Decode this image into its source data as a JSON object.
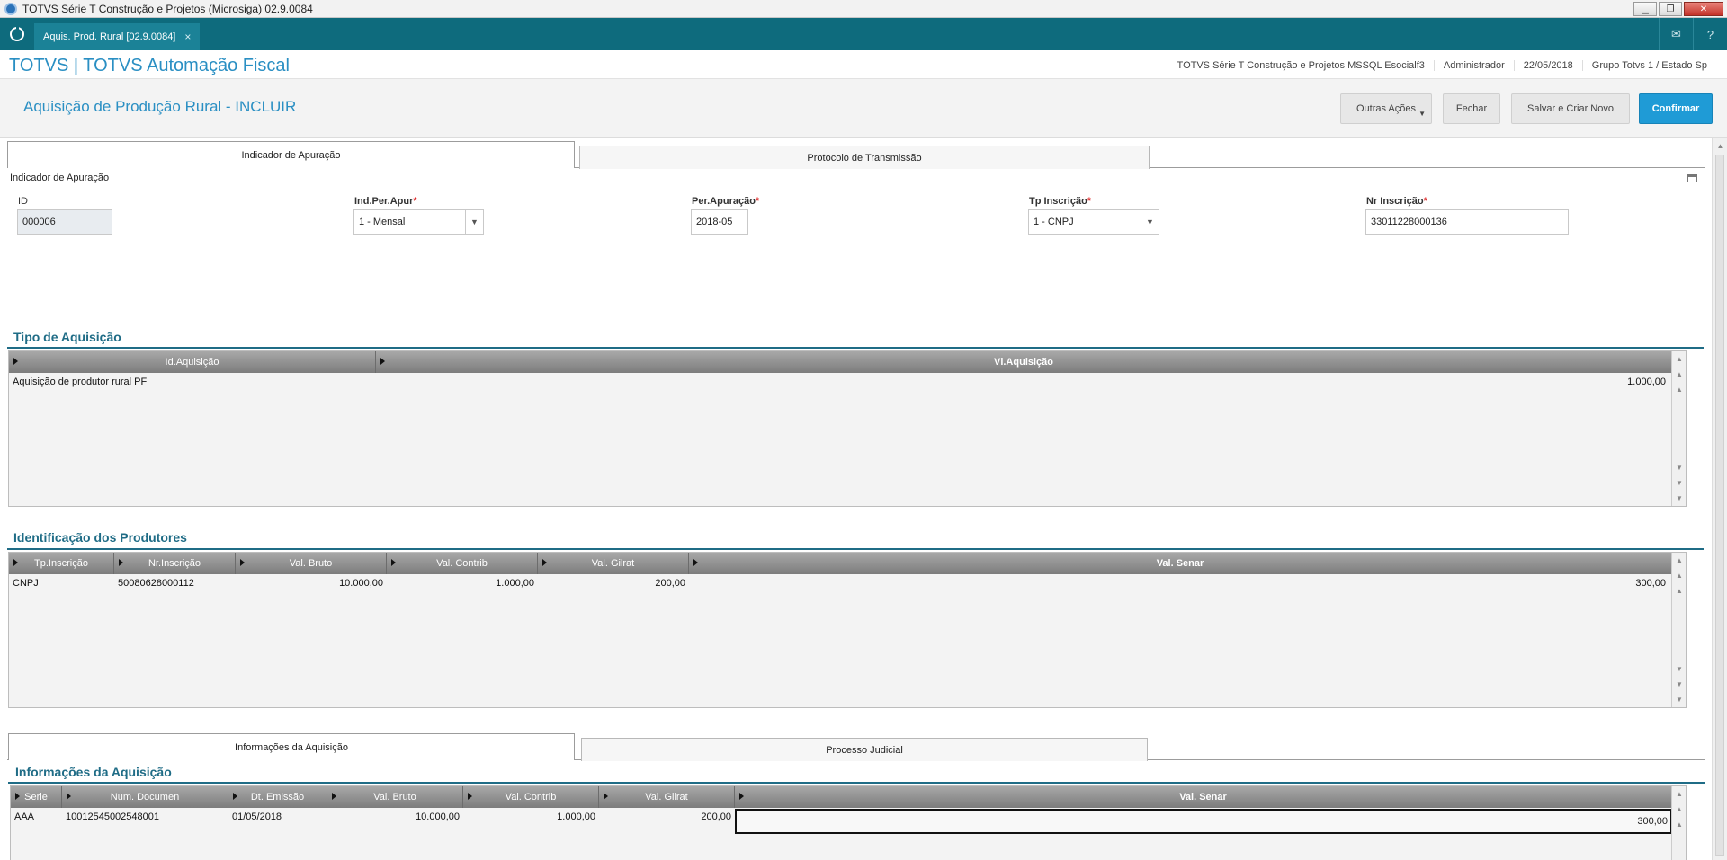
{
  "window": {
    "title": "TOTVS Série T Construção e Projetos (Microsiga) 02.9.0084"
  },
  "app_tab": {
    "label": "Aquis. Prod. Rural [02.9.0084]",
    "close": "×"
  },
  "topbar_icons": {
    "mail": "✉",
    "help": "?"
  },
  "header": {
    "brand": "TOTVS | TOTVS Automação Fiscal",
    "info": [
      "TOTVS Série T Construção e Projetos MSSQL Esocialf3",
      "Administrador",
      "22/05/2018",
      "Grupo Totvs 1 / Estado Sp"
    ]
  },
  "page": {
    "title": "Aquisição de Produção Rural - INCLUIR"
  },
  "actions": {
    "outras": "Outras Ações",
    "fechar": "Fechar",
    "salvar_novo": "Salvar e Criar Novo",
    "confirmar": "Confirmar"
  },
  "top_tabs": [
    "Indicador de Apuração",
    "Protocolo de Transmissão"
  ],
  "form": {
    "group_label": "Indicador de Apuração",
    "id": {
      "label": "ID",
      "value": "000006"
    },
    "ind_per_apur": {
      "label": "Ind.Per.Apur",
      "value": "1 - Mensal"
    },
    "per_apuracao": {
      "label": "Per.Apuração",
      "value": "2018-05"
    },
    "tp_inscricao": {
      "label": "Tp Inscrição",
      "value": "1 - CNPJ"
    },
    "nr_inscricao": {
      "label": "Nr Inscrição",
      "value": "33011228000136"
    },
    "required_mark": "*"
  },
  "tipo_aquisicao": {
    "title": "Tipo de Aquisição",
    "columns": [
      "Id.Aquisição",
      "Vl.Aquisição"
    ],
    "rows": [
      [
        "Aquisição de produtor rural PF",
        "1.000,00"
      ]
    ]
  },
  "produtores": {
    "title": "Identificação dos Produtores",
    "columns": [
      "Tp.Inscrição",
      "Nr.Inscrição",
      "Val. Bruto",
      "Val. Contrib",
      "Val. Gilrat",
      "Val. Senar"
    ],
    "rows": [
      [
        "CNPJ",
        "50080628000112",
        "10.000,00",
        "1.000,00",
        "200,00",
        "300,00"
      ]
    ]
  },
  "bottom_tabs": [
    "Informações da Aquisição",
    "Processo Judicial"
  ],
  "info_aquisicao": {
    "title": "Informações da Aquisição",
    "columns": [
      "Serie",
      "Num. Documen",
      "Dt. Emissão",
      "Val. Bruto",
      "Val. Contrib",
      "Val. Gilrat",
      "Val. Senar"
    ],
    "rows": [
      [
        "AAA",
        "10012545002548001",
        "01/05/2018",
        "10.000,00",
        "1.000,00",
        "200,00",
        "300,00"
      ]
    ]
  },
  "colors": {
    "teal": "#0e6b7d",
    "brand_blue": "#2a8fc3",
    "confirm": "#1f9bd6",
    "section": "#1f6c86"
  }
}
